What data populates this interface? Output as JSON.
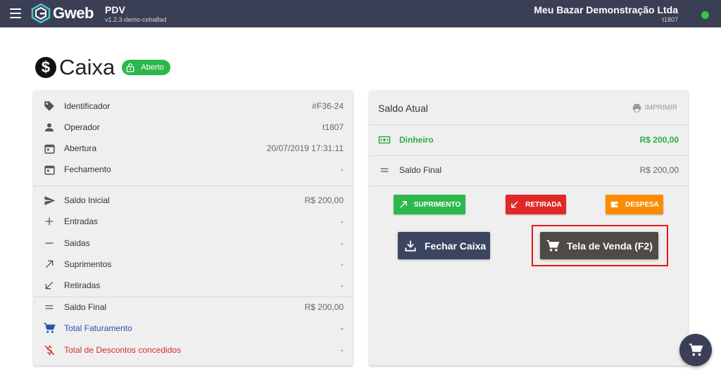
{
  "topbar": {
    "brand": "Gweb",
    "app_name": "PDV",
    "app_version": "v1.2.3-demo-ceba8ad",
    "company_name": "Meu Bazar Demonstração Ltda",
    "company_user": "t1807",
    "status_color": "#2ecc40"
  },
  "page": {
    "title": "Caixa",
    "title_icon": "dollar-circle-icon",
    "badge_label": "Aberto",
    "badge_color": "#2db84c"
  },
  "details": {
    "rows": [
      {
        "icon": "tag-icon",
        "label": "Identificador",
        "value": "#F36-24"
      },
      {
        "icon": "person-icon",
        "label": "Operador",
        "value": "t1807"
      },
      {
        "icon": "calendar-icon",
        "label": "Abertura",
        "value": "20/07/2019 17:31:11"
      },
      {
        "icon": "calendar-icon",
        "label": "Fechamento",
        "value": "-"
      },
      {
        "icon": "send-icon",
        "label": "Saldo Inicial",
        "value": "R$ 200,00"
      },
      {
        "icon": "plus-icon",
        "label": "Entradas",
        "value": "-"
      },
      {
        "icon": "minus-icon",
        "label": "Saidas",
        "value": "-"
      },
      {
        "icon": "arrow-up-right-icon",
        "label": "Suprimentos",
        "value": "-"
      },
      {
        "icon": "arrow-down-left-icon",
        "label": "Retiradas",
        "value": "-"
      },
      {
        "icon": "equals-icon",
        "label": "Saldo Final",
        "value": "R$ 200,00"
      },
      {
        "icon": "cart-icon",
        "label": "Total Faturamento",
        "value": "-"
      },
      {
        "icon": "discount-icon",
        "label": "Total de Descontos concedidos",
        "value": "-"
      }
    ]
  },
  "saldo": {
    "heading": "Saldo Atual",
    "print_label": "IMPRIMIR",
    "dinheiro_label": "Dinheiro",
    "dinheiro_value": "R$ 200,00",
    "final_label": "Saldo Final",
    "final_value": "R$ 200,00"
  },
  "actions": {
    "suprimento": "SUPRIMENTO",
    "retirada": "RETIRADA",
    "despesa": "DESPESA",
    "fechar_caixa": "Fechar Caixa",
    "tela_venda": "Tela de Venda (F2)"
  }
}
